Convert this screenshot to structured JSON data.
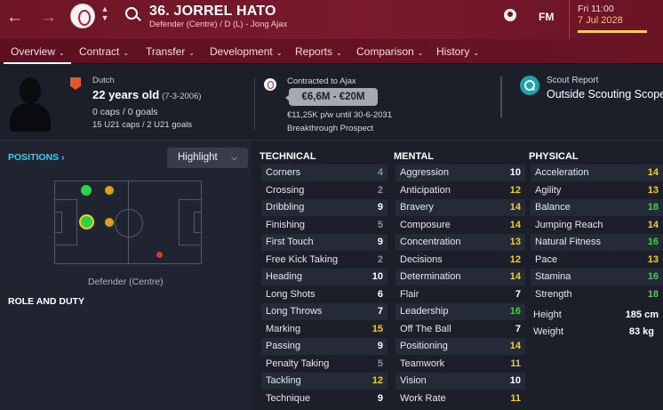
{
  "header": {
    "title": "36. JORREL HATO",
    "subtitle": "Defender (Centre) / D (L) - Jong Ajax",
    "brand": "FM",
    "date_day": "Fri 11:00",
    "date_full": "7 Jul 2028"
  },
  "nav": [
    {
      "label": "Overview"
    },
    {
      "label": "Contract"
    },
    {
      "label": "Transfer"
    },
    {
      "label": "Development"
    },
    {
      "label": "Reports"
    },
    {
      "label": "Comparison"
    },
    {
      "label": "History"
    }
  ],
  "info": {
    "nationality": "Dutch",
    "age": "22 years old",
    "dob": "(7-3-2006)",
    "caps": "0 caps / 0 goals",
    "u21": "15 U21 caps / 2 U21 goals",
    "contracted": "Contracted to Ajax",
    "value": "€6,6M - €20M",
    "wage": "€11,25K p/w until 30-6-2031",
    "prospect": "Breakthrough Prospect",
    "scout_title": "Scout Report",
    "scout_value": "Outside Scouting Scope"
  },
  "left": {
    "positions_title": "POSITIONS",
    "highlight": "Highlight",
    "position_label": "Defender (Centre)",
    "role_title": "ROLE AND DUTY"
  },
  "attributes": {
    "technical_title": "TECHNICAL",
    "mental_title": "MENTAL",
    "physical_title": "PHYSICAL",
    "technical": [
      {
        "label": "Corners",
        "value": "4"
      },
      {
        "label": "Crossing",
        "value": "2"
      },
      {
        "label": "Dribbling",
        "value": "9"
      },
      {
        "label": "Finishing",
        "value": "5"
      },
      {
        "label": "First Touch",
        "value": "9"
      },
      {
        "label": "Free Kick Taking",
        "value": "2"
      },
      {
        "label": "Heading",
        "value": "10"
      },
      {
        "label": "Long Shots",
        "value": "6"
      },
      {
        "label": "Long Throws",
        "value": "7"
      },
      {
        "label": "Marking",
        "value": "15"
      },
      {
        "label": "Passing",
        "value": "9"
      },
      {
        "label": "Penalty Taking",
        "value": "5"
      },
      {
        "label": "Tackling",
        "value": "12"
      },
      {
        "label": "Technique",
        "value": "9"
      }
    ],
    "mental": [
      {
        "label": "Aggression",
        "value": "10"
      },
      {
        "label": "Anticipation",
        "value": "12"
      },
      {
        "label": "Bravery",
        "value": "14"
      },
      {
        "label": "Composure",
        "value": "14"
      },
      {
        "label": "Concentration",
        "value": "13"
      },
      {
        "label": "Decisions",
        "value": "12"
      },
      {
        "label": "Determination",
        "value": "14"
      },
      {
        "label": "Flair",
        "value": "7"
      },
      {
        "label": "Leadership",
        "value": "16"
      },
      {
        "label": "Off The Ball",
        "value": "7"
      },
      {
        "label": "Positioning",
        "value": "14"
      },
      {
        "label": "Teamwork",
        "value": "11"
      },
      {
        "label": "Vision",
        "value": "10"
      },
      {
        "label": "Work Rate",
        "value": "11"
      }
    ],
    "physical": [
      {
        "label": "Acceleration",
        "value": "14"
      },
      {
        "label": "Agility",
        "value": "13"
      },
      {
        "label": "Balance",
        "value": "18"
      },
      {
        "label": "Jumping Reach",
        "value": "14"
      },
      {
        "label": "Natural Fitness",
        "value": "16"
      },
      {
        "label": "Pace",
        "value": "13"
      },
      {
        "label": "Stamina",
        "value": "16"
      },
      {
        "label": "Strength",
        "value": "18"
      }
    ],
    "height_label": "Height",
    "height_value": "185 cm",
    "weight_label": "Weight",
    "weight_value": "83 kg"
  },
  "colors": {
    "header": "#7a1a2c",
    "accent_cyan": "#2fd0ea",
    "grade_low": "#8d909a",
    "grade_mid": "#ffffff",
    "grade_good": "#f2d01c",
    "grade_great": "#3fd23f"
  }
}
